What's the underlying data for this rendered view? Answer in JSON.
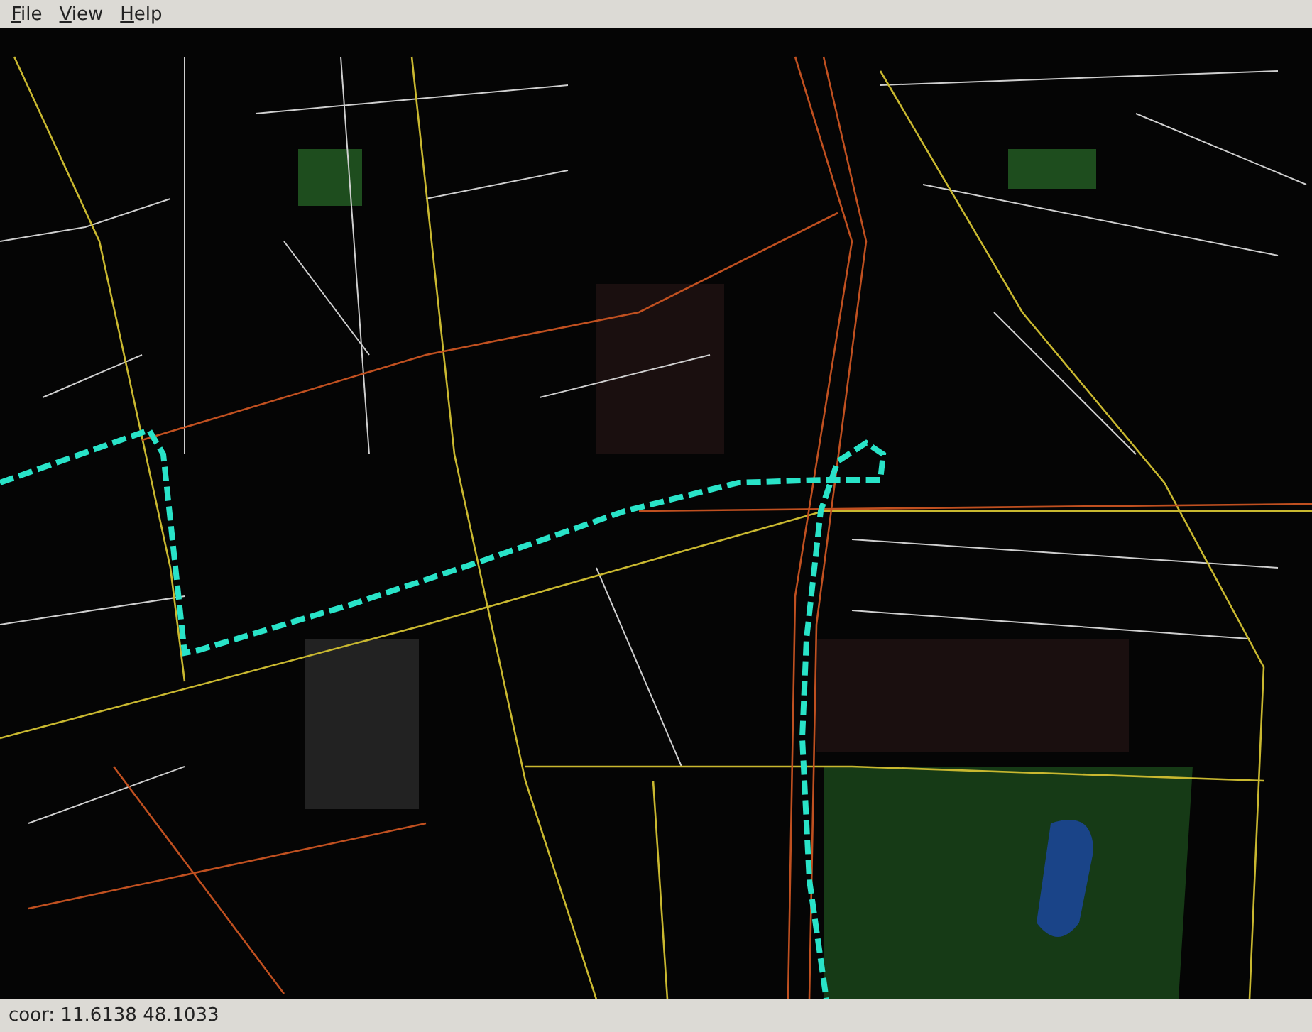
{
  "menu": [
    "File",
    "View",
    "Help"
  ],
  "status_bar": {
    "text": "coor: 11.6138 48.1033"
  }
}
